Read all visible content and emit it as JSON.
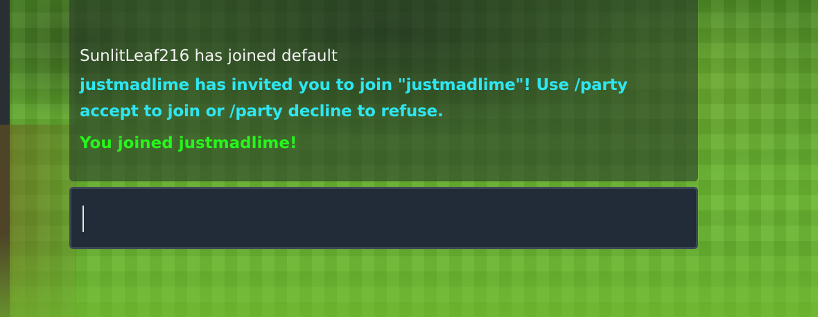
{
  "chat": {
    "messages": [
      {
        "text": "SunlitLeaf216 has joined default",
        "color": "#f2f2f2"
      },
      {
        "text": "justmadlime has invited you to join \"justmadlime\"! Use /party accept to join or /party decline to refuse.",
        "color": "#2ee6f0"
      },
      {
        "text": "You joined justmadlime!",
        "color": "#27f51c"
      }
    ],
    "input_value": ""
  }
}
